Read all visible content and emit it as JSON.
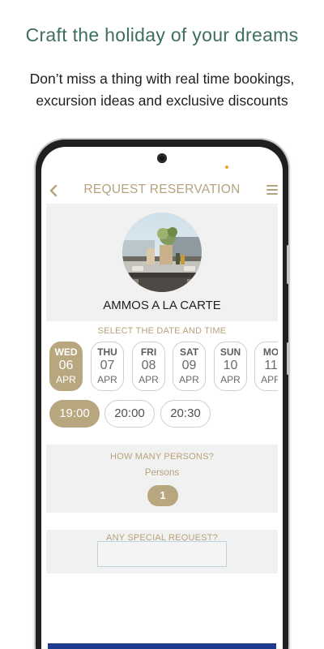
{
  "promo": {
    "headline": "Craft the holiday of your dreams",
    "subline": "Don’t miss a thing with real time bookings, excursion ideas and exclusive discounts"
  },
  "app_bar": {
    "back_icon": "chevron-left-icon",
    "title": "REQUEST RESERVATION",
    "menu_icon": "hamburger-menu-icon"
  },
  "venue": {
    "name": "AMMOS A LA CARTE",
    "photo": "restaurant-table-photo"
  },
  "date_section": {
    "label": "SELECT THE DATE AND TIME",
    "dates": [
      {
        "dow": "WED",
        "day": "06",
        "month": "APR",
        "selected": true
      },
      {
        "dow": "THU",
        "day": "07",
        "month": "APR",
        "selected": false
      },
      {
        "dow": "FRI",
        "day": "08",
        "month": "APR",
        "selected": false
      },
      {
        "dow": "SAT",
        "day": "09",
        "month": "APR",
        "selected": false
      },
      {
        "dow": "SUN",
        "day": "10",
        "month": "APR",
        "selected": false
      },
      {
        "dow": "MO",
        "day": "11",
        "month": "APR",
        "selected": false
      }
    ],
    "times": [
      {
        "label": "19:00",
        "selected": true
      },
      {
        "label": "20:00",
        "selected": false
      },
      {
        "label": "20:30",
        "selected": false
      }
    ]
  },
  "persons": {
    "question": "HOW MANY PERSONS?",
    "label": "Persons",
    "count": "1"
  },
  "special_request": {
    "question": "ANY SPECIAL REQUEST?",
    "value": ""
  },
  "colors": {
    "accent": "#b8a67f",
    "headline": "#3d6e5e",
    "section_bg": "#f1f1f1",
    "bottom_bar": "#1c3d8f"
  }
}
